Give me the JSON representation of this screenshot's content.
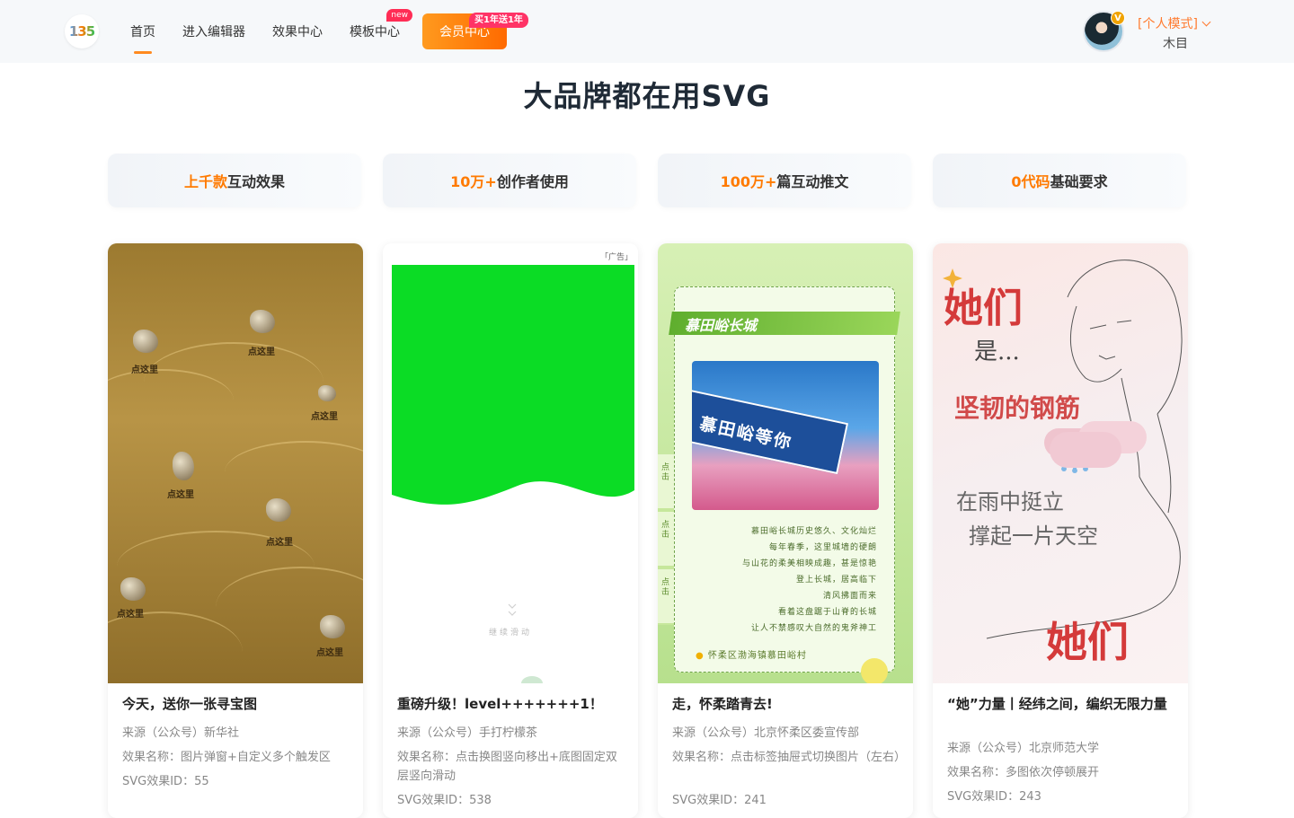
{
  "header": {
    "logo_text": "135",
    "nav": [
      {
        "label": "首页",
        "active": true
      },
      {
        "label": "进入编辑器"
      },
      {
        "label": "效果中心"
      },
      {
        "label": "模板中心",
        "badge": "new"
      }
    ],
    "vip_button": "会员中心",
    "vip_promo": "买1年送1年",
    "user": {
      "badge": "V",
      "mode": "[个人模式]",
      "name": "木目"
    }
  },
  "page_title": "大品牌都在用SVG",
  "stats": [
    {
      "highlight": "上千款",
      "text": "互动效果"
    },
    {
      "highlight": "10万+",
      "text": "创作者使用"
    },
    {
      "highlight": "100万+",
      "text": "篇互动推文"
    },
    {
      "highlight": "0代码",
      "text": "基础要求"
    }
  ],
  "cards": [
    {
      "title": "今天，送你一张寻宝图",
      "source": "来源（公众号）新华社",
      "effect": "效果名称：图片弹窗+自定义多个触发区",
      "svg_id": "SVG效果ID：55",
      "thumb_labels": [
        "点这里",
        "点这里",
        "点这里",
        "点这里",
        "点这里",
        "点这里",
        "点这里"
      ]
    },
    {
      "title": "重磅升级！level+++++++1！",
      "source": "来源（公众号）手打柠檬茶",
      "effect": "效果名称：点击换图竖向移出+底图固定双层竖向滑动",
      "svg_id": "SVG效果ID：538",
      "thumb_ad": "「广告」",
      "thumb_hint": "继续滑动"
    },
    {
      "title": "走，怀柔踏青去!",
      "source": "来源（公众号）北京怀柔区委宣传部",
      "effect": "效果名称：点击标签抽屉式切换图片（左右）",
      "svg_id": "SVG效果ID：241",
      "thumb_banner": "慕田峪长城",
      "thumb_sign": "慕田峪等你",
      "thumb_tabs": [
        "点击",
        "点击",
        "点击"
      ],
      "thumb_lines": [
        "慕田峪长城历史悠久、文化灿烂",
        "每年春季，这里城墙的硬朗",
        "与山花的柔美相映成趣，甚是惊艳",
        "登上长城，居高临下",
        "清风拂面而来",
        "看着这盘踞于山脊的长城",
        "让人不禁感叹大自然的鬼斧神工"
      ],
      "thumb_location": "怀柔区渤海镇慕田峪村"
    },
    {
      "title": "“她”力量丨经纬之间，编织无限力量",
      "source": "来源（公众号）北京师范大学",
      "effect": "效果名称：多图依次停顿展开",
      "svg_id": "SVG效果ID：243",
      "thumb_texts": [
        "她们",
        "是...",
        "坚韧的钢筋",
        "在雨中挺立",
        "撑起一片天空",
        "她们"
      ]
    }
  ],
  "colors": {
    "accent": "#ff7a00",
    "vip_gradient_start": "#ff9a1e",
    "vip_gradient_end": "#ff6a00",
    "badge": "#ff2d55"
  }
}
